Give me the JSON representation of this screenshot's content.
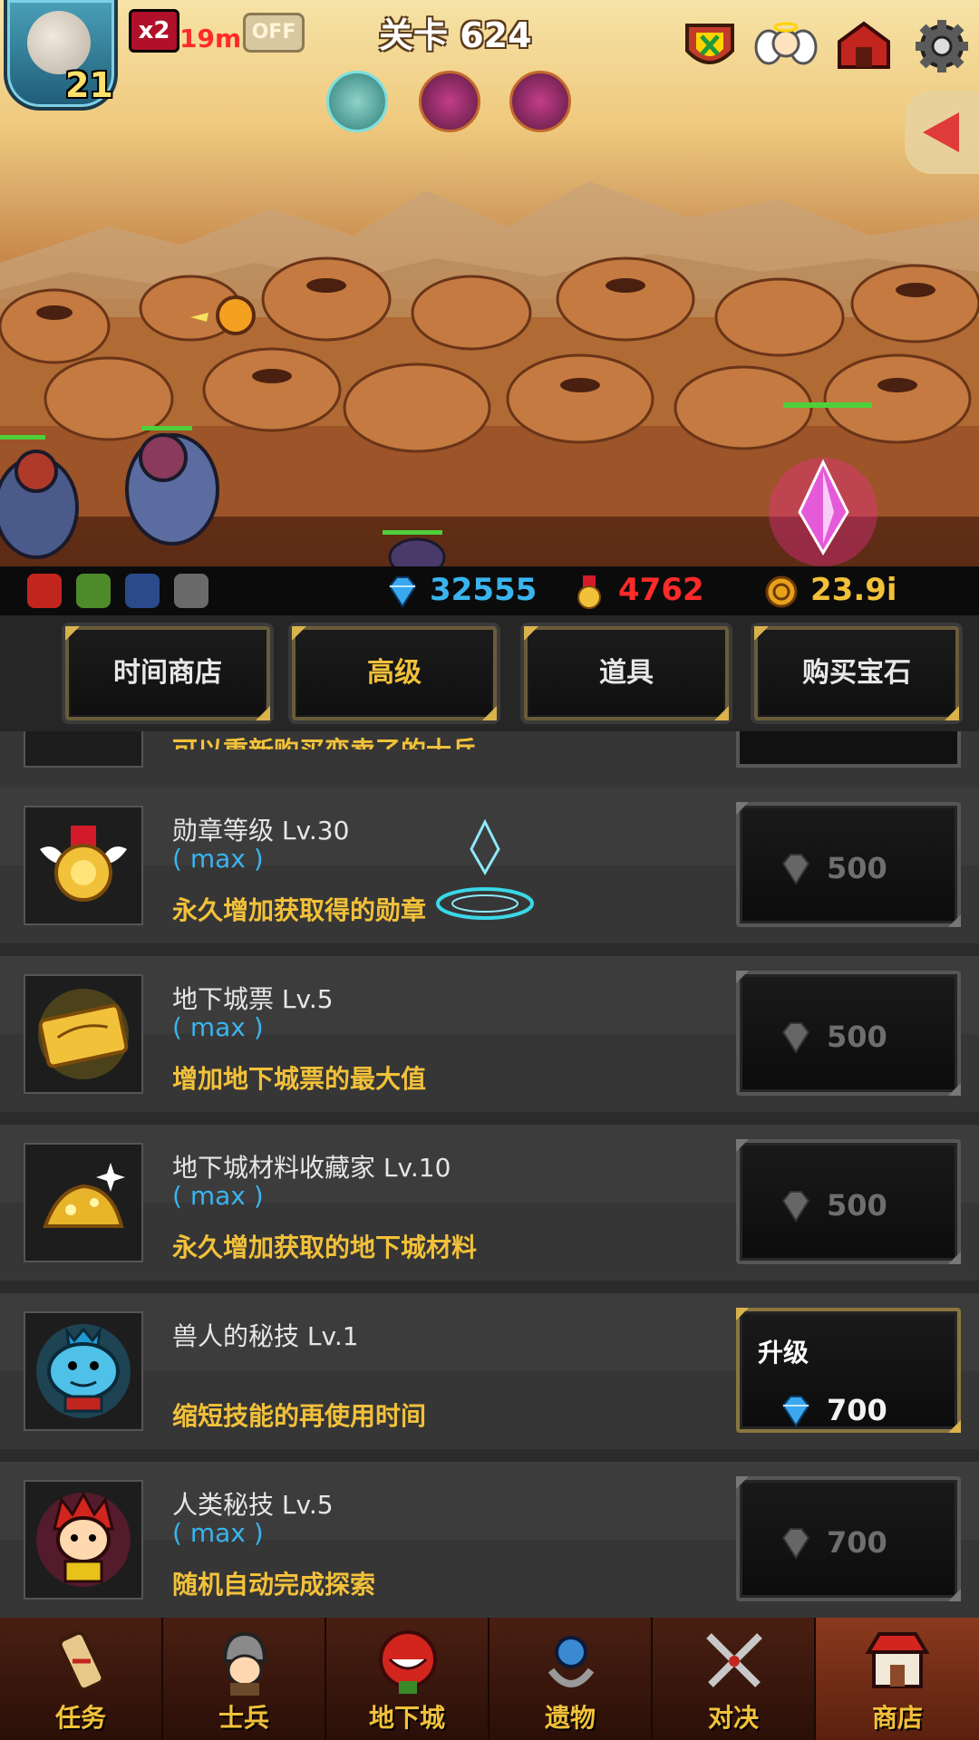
{
  "hud": {
    "hero_level": "21",
    "speed_multiplier": "x2",
    "speed_time": "19m",
    "auto_toggle": "OFF",
    "stage_title": "关卡 624"
  },
  "resources": {
    "gems": "32555",
    "medals": "4762",
    "gold": "23.9i"
  },
  "shop_tabs": [
    {
      "label": "时间商店",
      "active": false
    },
    {
      "label": "高级",
      "active": true
    },
    {
      "label": "道具",
      "active": false
    },
    {
      "label": "购买宝石",
      "active": false
    }
  ],
  "partial_item": {
    "desc": "可以重新购买变卖了的士兵"
  },
  "items": [
    {
      "name": "勋章等级 Lv.30",
      "max": "( max )",
      "desc": "永久增加获取得的勋章",
      "price": "500",
      "enabled": false,
      "icon": "medal-icon"
    },
    {
      "name": "地下城票 Lv.5",
      "max": "( max )",
      "desc": "增加地下城票的最大值",
      "price": "500",
      "enabled": false,
      "icon": "dungeon-ticket-icon"
    },
    {
      "name": "地下城材料收藏家 Lv.10",
      "max": "( max )",
      "desc": "永久增加获取的地下城材料",
      "price": "500",
      "enabled": false,
      "icon": "material-pile-icon"
    },
    {
      "name": "兽人的秘技 Lv.1",
      "max": "",
      "desc": "缩短技能的再使用时间",
      "price": "700",
      "enabled": true,
      "action": "升级",
      "icon": "orc-icon"
    },
    {
      "name": "人类秘技 Lv.5",
      "max": "( max )",
      "desc": "随机自动完成探索",
      "price": "700",
      "enabled": false,
      "icon": "human-icon"
    }
  ],
  "nav": [
    {
      "label": "任务",
      "icon": "scroll-icon",
      "active": false
    },
    {
      "label": "士兵",
      "icon": "soldier-icon",
      "active": false
    },
    {
      "label": "地下城",
      "icon": "dungeon-icon",
      "active": false
    },
    {
      "label": "遗物",
      "icon": "relic-icon",
      "active": false
    },
    {
      "label": "对决",
      "icon": "crossed-swords-icon",
      "active": false
    },
    {
      "label": "商店",
      "icon": "shop-icon",
      "active": true
    }
  ],
  "colors": {
    "accent_gold": "#f2c13a",
    "max_blue": "#3ab4ee",
    "medal_red": "#ff2a2a",
    "nav_active": "#8a3a1e"
  }
}
